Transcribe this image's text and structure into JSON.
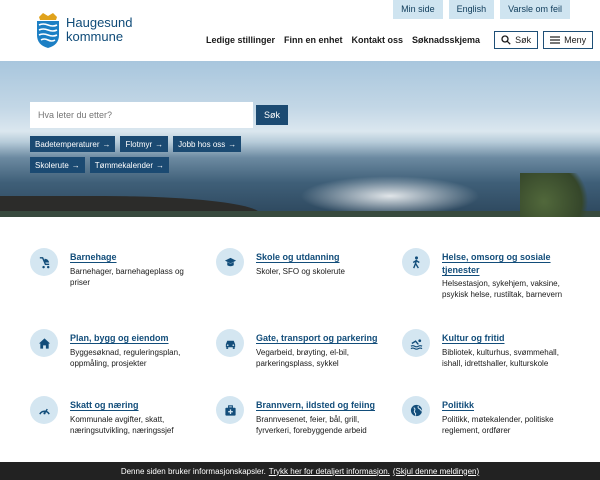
{
  "utility_nav": [
    "Min side",
    "English",
    "Varsle om feil"
  ],
  "logo": {
    "line1": "Haugesund",
    "line2": "kommune"
  },
  "main_nav": {
    "links": [
      "Ledige stillinger",
      "Finn en enhet",
      "Kontakt oss",
      "Søknadsskjema"
    ],
    "search_button": "Søk",
    "menu_button": "Meny"
  },
  "hero": {
    "search_placeholder": "Hva leter du etter?",
    "search_button": "Søk",
    "quick_links": [
      "Badetemperaturer",
      "Flotmyr",
      "Jobb hos oss",
      "Skolerute",
      "Tømmekalender"
    ],
    "arrow": "→"
  },
  "services": [
    {
      "title": "Barnehage",
      "desc": "Barnehager, barnehageplass og priser",
      "icon": "stroller-icon"
    },
    {
      "title": "Skole og utdanning",
      "desc": "Skoler, SFO og skolerute",
      "icon": "graduation-cap-icon"
    },
    {
      "title": "Helse, omsorg og sosiale tjenester",
      "desc": "Helsestasjon, sykehjem, vaksine, psykisk helse, rustiltak, barnevern",
      "icon": "walking-person-icon"
    },
    {
      "title": "Plan, bygg og eiendom",
      "desc": "Byggesøknad, reguleringsplan, oppmåling, prosjekter",
      "icon": "house-icon"
    },
    {
      "title": "Gate, transport og parkering",
      "desc": "Vegarbeid, brøyting, el-bil, parkeringsplass, sykkel",
      "icon": "car-icon"
    },
    {
      "title": "Kultur og fritid",
      "desc": "Bibliotek, kulturhus, svømmehall, ishall, idrettshaller, kulturskole",
      "icon": "swimmer-icon"
    },
    {
      "title": "Skatt og næring",
      "desc": "Kommunale avgifter, skatt, næringsutvikling, næringssjef",
      "icon": "gauge-icon"
    },
    {
      "title": "Brannvern, ildsted og feiing",
      "desc": "Brannvesenet, feier, bål, grill, fyrverkeri, forebyggende arbeid",
      "icon": "first-aid-kit-icon"
    },
    {
      "title": "Politikk",
      "desc": "Politikk, møtekalender, politiske reglement, ordfører",
      "icon": "globe-icon"
    }
  ],
  "cookie": {
    "text": "Denne siden bruker informasjonskapsler.",
    "link1": "Trykk her for detaljert informasjon.",
    "link2": "(Skjul denne meldingen)"
  },
  "colors": {
    "brand": "#1b4a72",
    "link": "#124d7a",
    "icon_bg": "#d4e6f1",
    "utility_bg": "#cfe4f0"
  }
}
